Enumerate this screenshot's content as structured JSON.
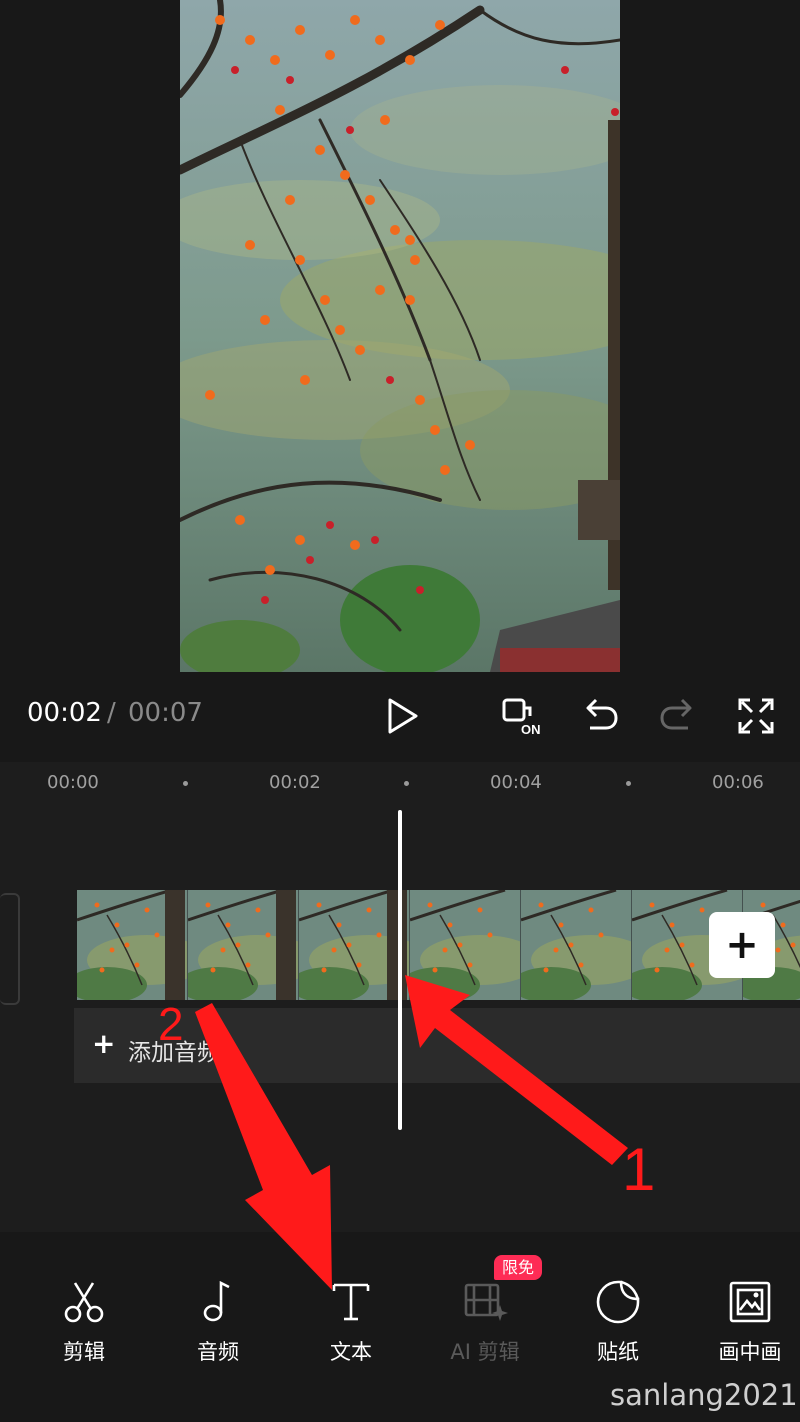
{
  "player": {
    "current_time": "00:02",
    "separator": "/",
    "total_time": "00:07"
  },
  "controls": {
    "icons": [
      "play-icon",
      "toggle-on-icon",
      "undo-icon",
      "redo-icon",
      "fullscreen-icon"
    ],
    "toggle_text": "ON"
  },
  "timeline": {
    "ruler": [
      "00:00",
      "00:02",
      "00:04",
      "00:06"
    ],
    "add_audio_label": "添加音频",
    "add_audio_plus": "+",
    "add_clip_plus": "+"
  },
  "toolbar": {
    "items": [
      {
        "label": "剪辑",
        "icon": "scissors-icon"
      },
      {
        "label": "音频",
        "icon": "music-note-icon"
      },
      {
        "label": "文本",
        "icon": "text-icon"
      },
      {
        "label": "AI 剪辑",
        "icon": "ai-edit-icon"
      },
      {
        "label": "贴纸",
        "icon": "sticker-icon"
      },
      {
        "label": "画中画",
        "icon": "picture-in-picture-icon"
      }
    ],
    "badge": "限免"
  },
  "annotations": {
    "marker_1": "1",
    "marker_2": "2",
    "arrow_color": "#ff1a1a"
  },
  "watermark": "sanlang2021",
  "colors": {
    "background": "#181818",
    "badge": "#fe2c55",
    "dim_text": "#5a5a5a"
  }
}
